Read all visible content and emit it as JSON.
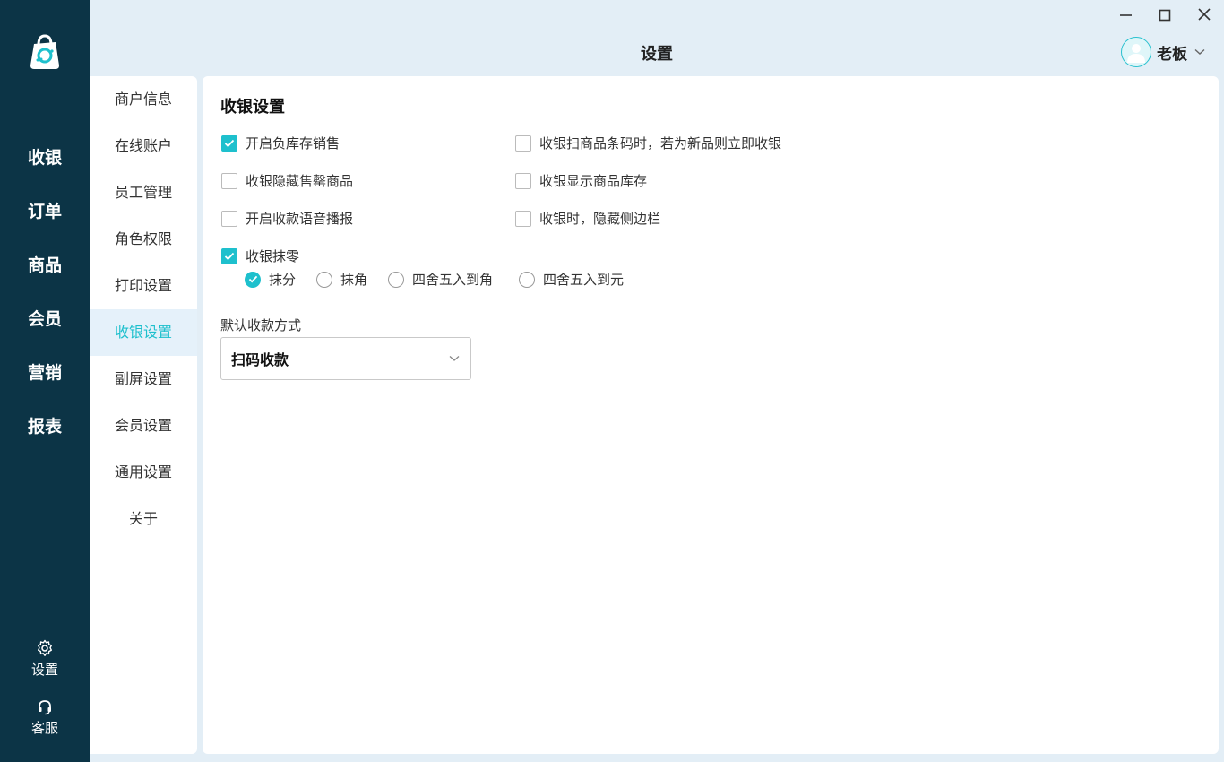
{
  "window": {
    "title": "设置",
    "controls": [
      "minimize-icon",
      "maximize-icon",
      "close-icon"
    ]
  },
  "user": {
    "name": "老板",
    "avatar_icon": "user-avatar-icon",
    "chevron_icon": "chevron-down-icon"
  },
  "sidebar": {
    "logo_icon": "shopping-bag-logo-icon",
    "items": [
      {
        "label": "收银"
      },
      {
        "label": "订单"
      },
      {
        "label": "商品"
      },
      {
        "label": "会员"
      },
      {
        "label": "营销"
      },
      {
        "label": "报表"
      }
    ],
    "bottom": [
      {
        "label": "设置",
        "icon": "gear-icon"
      },
      {
        "label": "客服",
        "icon": "headset-icon"
      }
    ]
  },
  "settings_menu": {
    "active_index": 5,
    "items": [
      {
        "label": "商户信息"
      },
      {
        "label": "在线账户"
      },
      {
        "label": "员工管理"
      },
      {
        "label": "角色权限"
      },
      {
        "label": "打印设置"
      },
      {
        "label": "收银设置"
      },
      {
        "label": "副屏设置"
      },
      {
        "label": "会员设置"
      },
      {
        "label": "通用设置"
      },
      {
        "label": "关于"
      }
    ]
  },
  "checkout_settings": {
    "title": "收银设置",
    "options": [
      {
        "label": "开启负库存销售",
        "checked": true
      },
      {
        "label": "收银扫商品条码时，若为新品则立即收银",
        "checked": false
      },
      {
        "label": "收银隐藏售罄商品",
        "checked": false
      },
      {
        "label": "收银显示商品库存",
        "checked": false
      },
      {
        "label": "开启收款语音播报",
        "checked": false
      },
      {
        "label": "收银时，隐藏侧边栏",
        "checked": false
      },
      {
        "label": "收银抹零",
        "checked": true
      }
    ],
    "rounding": {
      "selected": 0,
      "options": [
        {
          "label": "抹分"
        },
        {
          "label": "抹角"
        },
        {
          "label": "四舍五入到角"
        },
        {
          "label": "四舍五入到元"
        }
      ]
    },
    "default_payment": {
      "label": "默认收款方式",
      "value": "扫码收款"
    }
  },
  "colors": {
    "sidebar_bg": "#0c3446",
    "accent": "#1ec0cd",
    "page_bg": "#e3eef6",
    "menu_active_bg": "#e5f1fa"
  }
}
